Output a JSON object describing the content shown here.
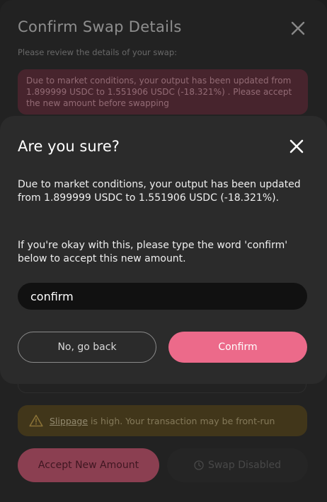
{
  "background_dialog": {
    "title": "Confirm Swap Details",
    "subtitle": "Please review the details of your swap:",
    "warning_text": "Due to market conditions, your output has been updated from 1.899999 USDC to 1.551906 USDC (-18.321%) . Please accept the new amount before swapping",
    "slippage_link": "Slippage",
    "slippage_text": "is high. Your transaction may be front-run",
    "accept_label": "Accept New Amount",
    "swap_disabled_label": "Swap Disabled"
  },
  "modal": {
    "title": "Are you sure?",
    "message": "Due to market conditions, your output has been updated from 1.899999 USDC to 1.551906 USDC (-18.321%).",
    "instruction": "If you're okay with this, please type the word 'confirm' below to accept this new amount.",
    "input_value": "confirm",
    "back_label": "No, go back",
    "confirm_label": "Confirm"
  },
  "colors": {
    "accent": "#ec6a8a",
    "warning_bg": "#6a2a3a",
    "slippage_bg": "#5e4a18"
  }
}
